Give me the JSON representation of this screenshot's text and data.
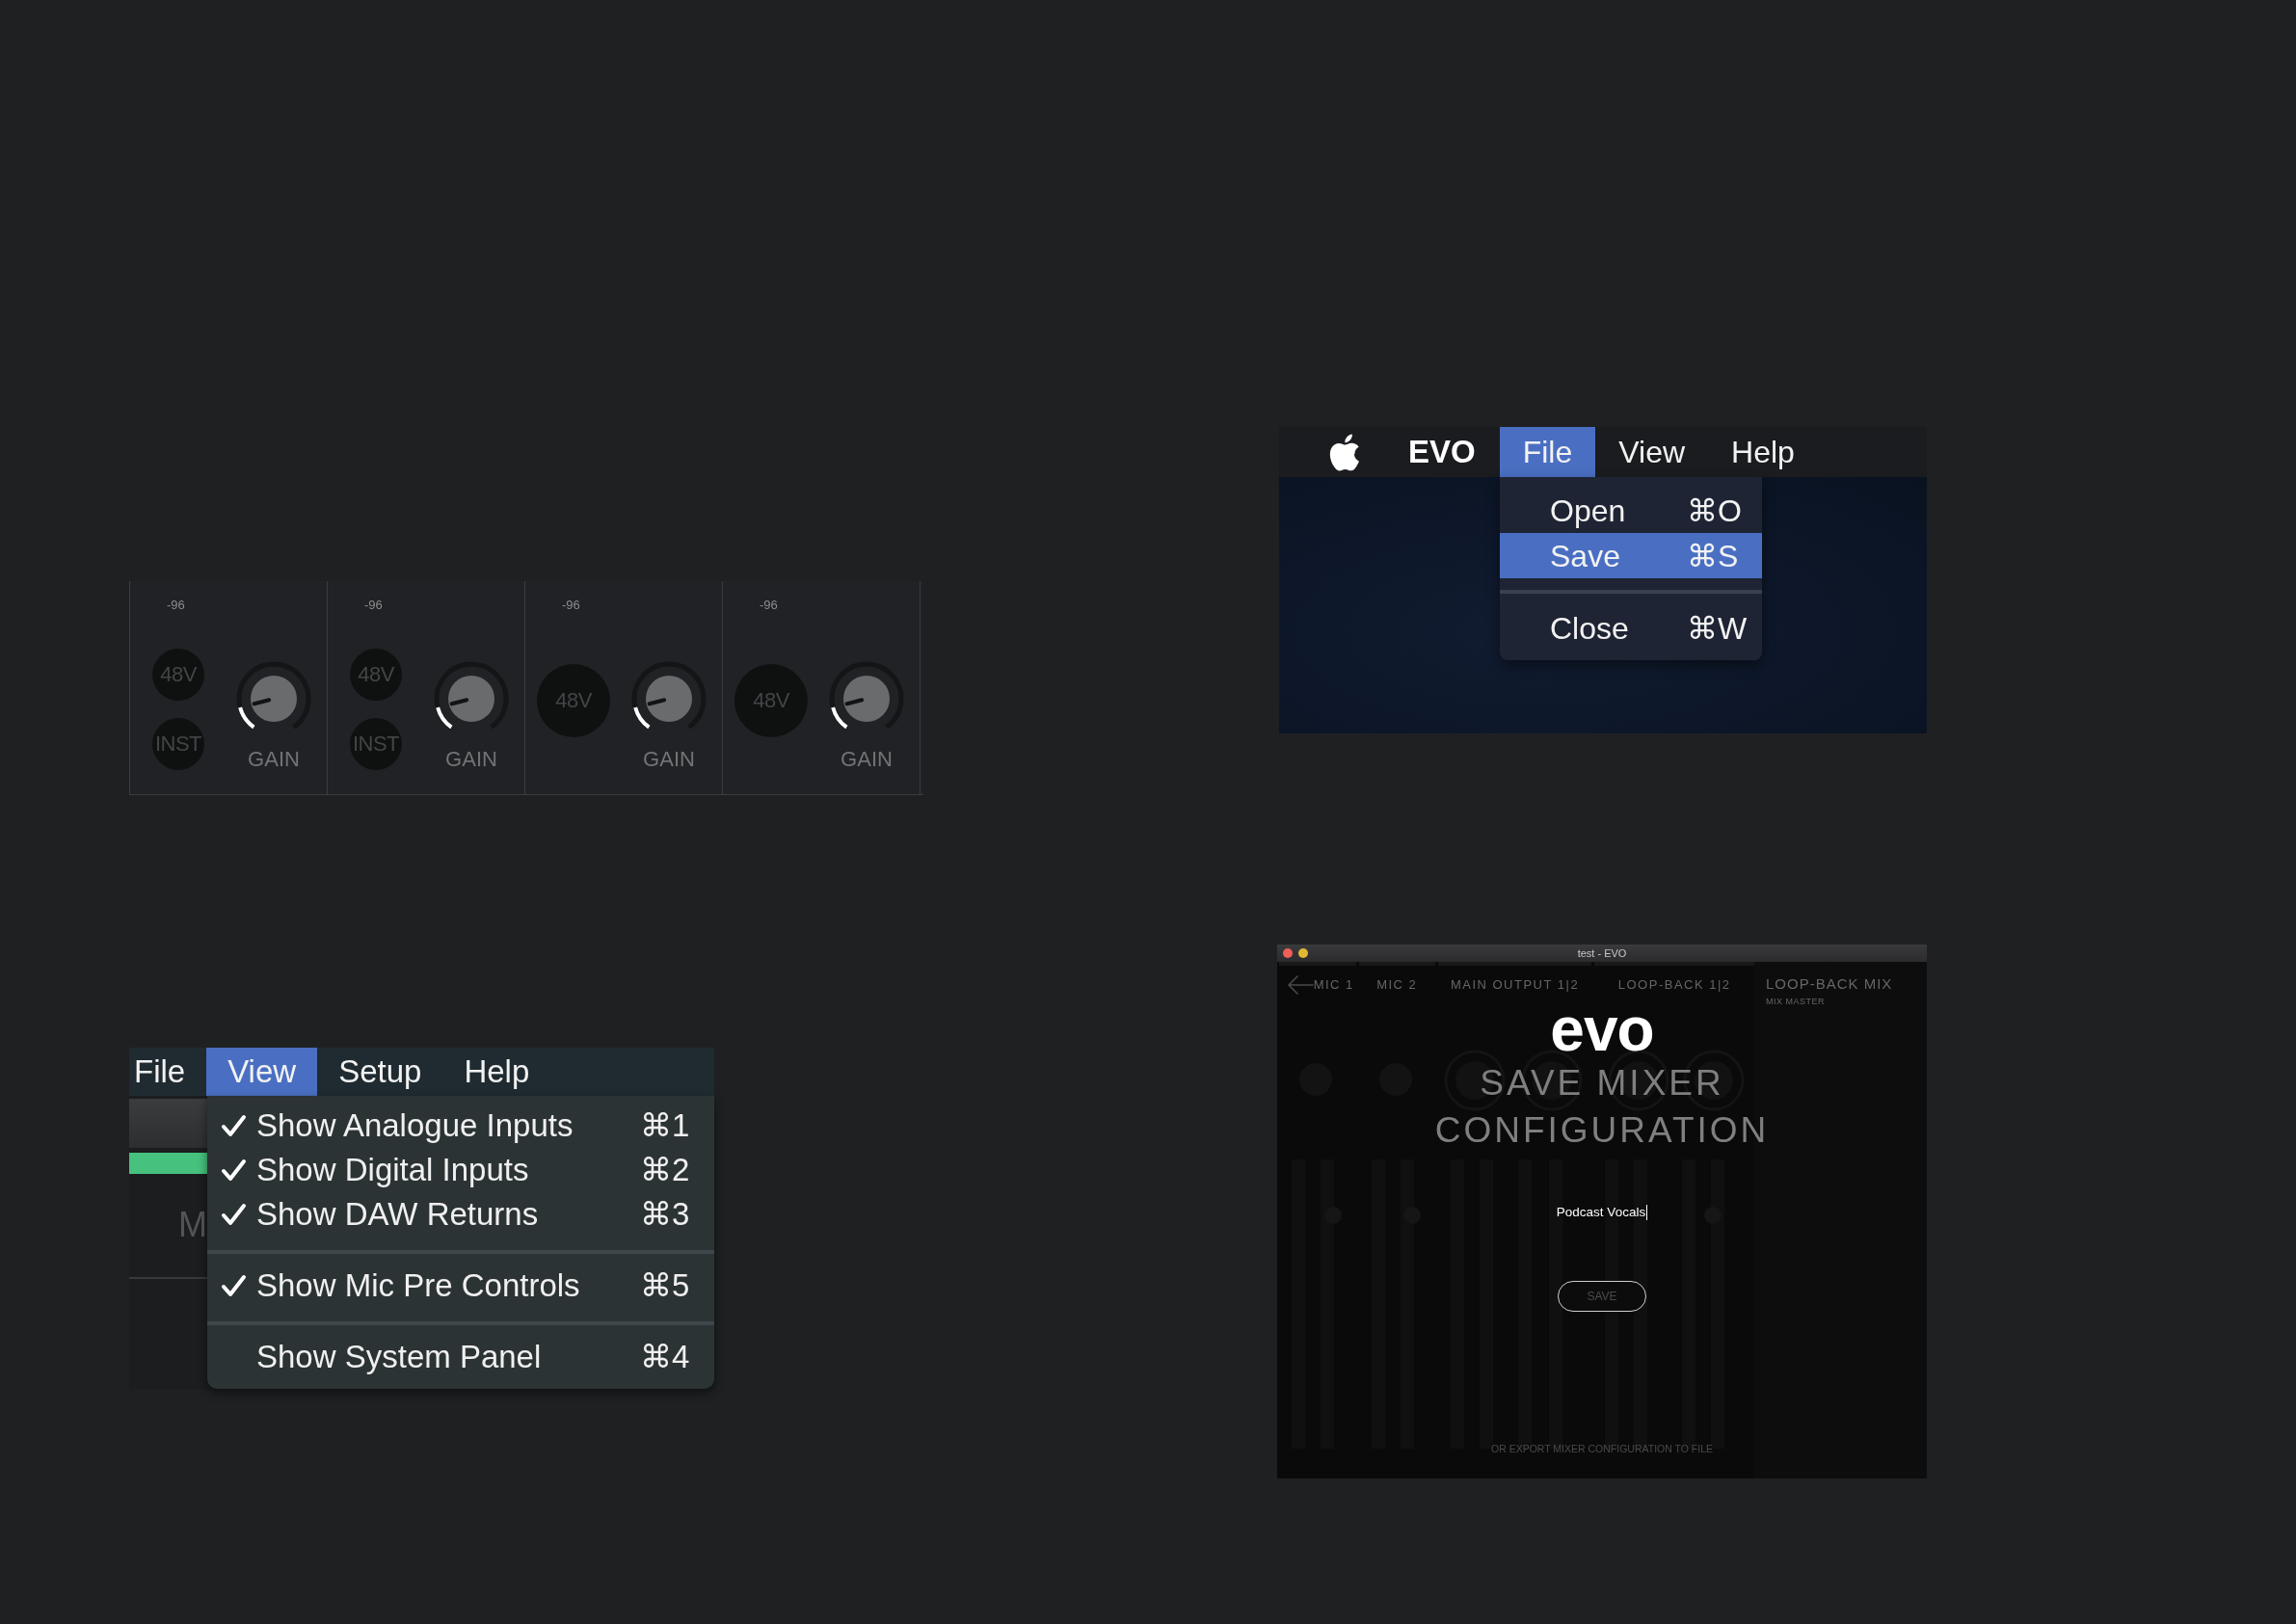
{
  "mic_pre_panel": {
    "channels": [
      {
        "meter_reading": "-96",
        "buttons": [
          {
            "label": "48V",
            "on": false
          },
          {
            "label": "INST",
            "on": false
          }
        ],
        "gain": {
          "label": "GAIN",
          "level": 0.14
        }
      },
      {
        "meter_reading": "-96",
        "buttons": [
          {
            "label": "48V",
            "on": false
          },
          {
            "label": "INST",
            "on": false
          }
        ],
        "gain": {
          "label": "GAIN",
          "level": 0.14
        }
      },
      {
        "meter_reading": "-96",
        "buttons": [
          {
            "label": "48V",
            "on": false
          }
        ],
        "gain": {
          "label": "GAIN",
          "level": 0.14
        }
      },
      {
        "meter_reading": "-96",
        "buttons": [
          {
            "label": "48V",
            "on": false
          }
        ],
        "gain": {
          "label": "GAIN",
          "level": 0.14
        }
      }
    ]
  },
  "view_menu_panel": {
    "menu_bar": [
      {
        "label": "File",
        "selected": false
      },
      {
        "label": "View",
        "selected": true
      },
      {
        "label": "Setup",
        "selected": false
      },
      {
        "label": "Help",
        "selected": false
      }
    ],
    "partial_label": "M",
    "menu_items": [
      {
        "kind": "item",
        "label": "Show Analogue Inputs",
        "shortcut": "⌘1",
        "checked": true,
        "selected": false
      },
      {
        "kind": "item",
        "label": "Show Digital Inputs",
        "shortcut": "⌘2",
        "checked": true,
        "selected": false
      },
      {
        "kind": "item",
        "label": "Show DAW Returns",
        "shortcut": "⌘3",
        "checked": true,
        "selected": false
      },
      {
        "kind": "separator"
      },
      {
        "kind": "item",
        "label": "Show Mic Pre Controls",
        "shortcut": "⌘5",
        "checked": true,
        "selected": false
      },
      {
        "kind": "separator"
      },
      {
        "kind": "item",
        "label": "Show System Panel",
        "shortcut": "⌘4",
        "checked": false,
        "selected": false
      }
    ]
  },
  "evo_menu_panel": {
    "app_name": "EVO",
    "menu_bar": [
      {
        "label": "File",
        "selected": true
      },
      {
        "label": "View",
        "selected": false
      },
      {
        "label": "Help",
        "selected": false
      }
    ],
    "menu_items": [
      {
        "kind": "item",
        "label": "Open",
        "shortcut": "⌘O",
        "selected": false
      },
      {
        "kind": "item",
        "label": "Save",
        "shortcut": "⌘S",
        "selected": true
      },
      {
        "kind": "separator"
      },
      {
        "kind": "item",
        "label": "Close",
        "shortcut": "⌘W",
        "selected": false
      }
    ]
  },
  "save_window": {
    "title": "test - EVO",
    "channel_labels": [
      "MIC 1",
      "MIC 2",
      "MAIN OUTPUT 1|2",
      "LOOP-BACK 1|2"
    ],
    "side_panel": {
      "title": "LOOP-BACK MIX",
      "subtitle": "MIX MASTER"
    },
    "logo": "evo",
    "heading": "SAVE MIXER CONFIGURATION",
    "name_field": {
      "value": "Podcast Vocals",
      "focused": true
    },
    "save_button": {
      "label": "SAVE",
      "disabled": true
    },
    "export_link": "OR EXPORT MIXER CONFIGURATION TO FILE"
  }
}
